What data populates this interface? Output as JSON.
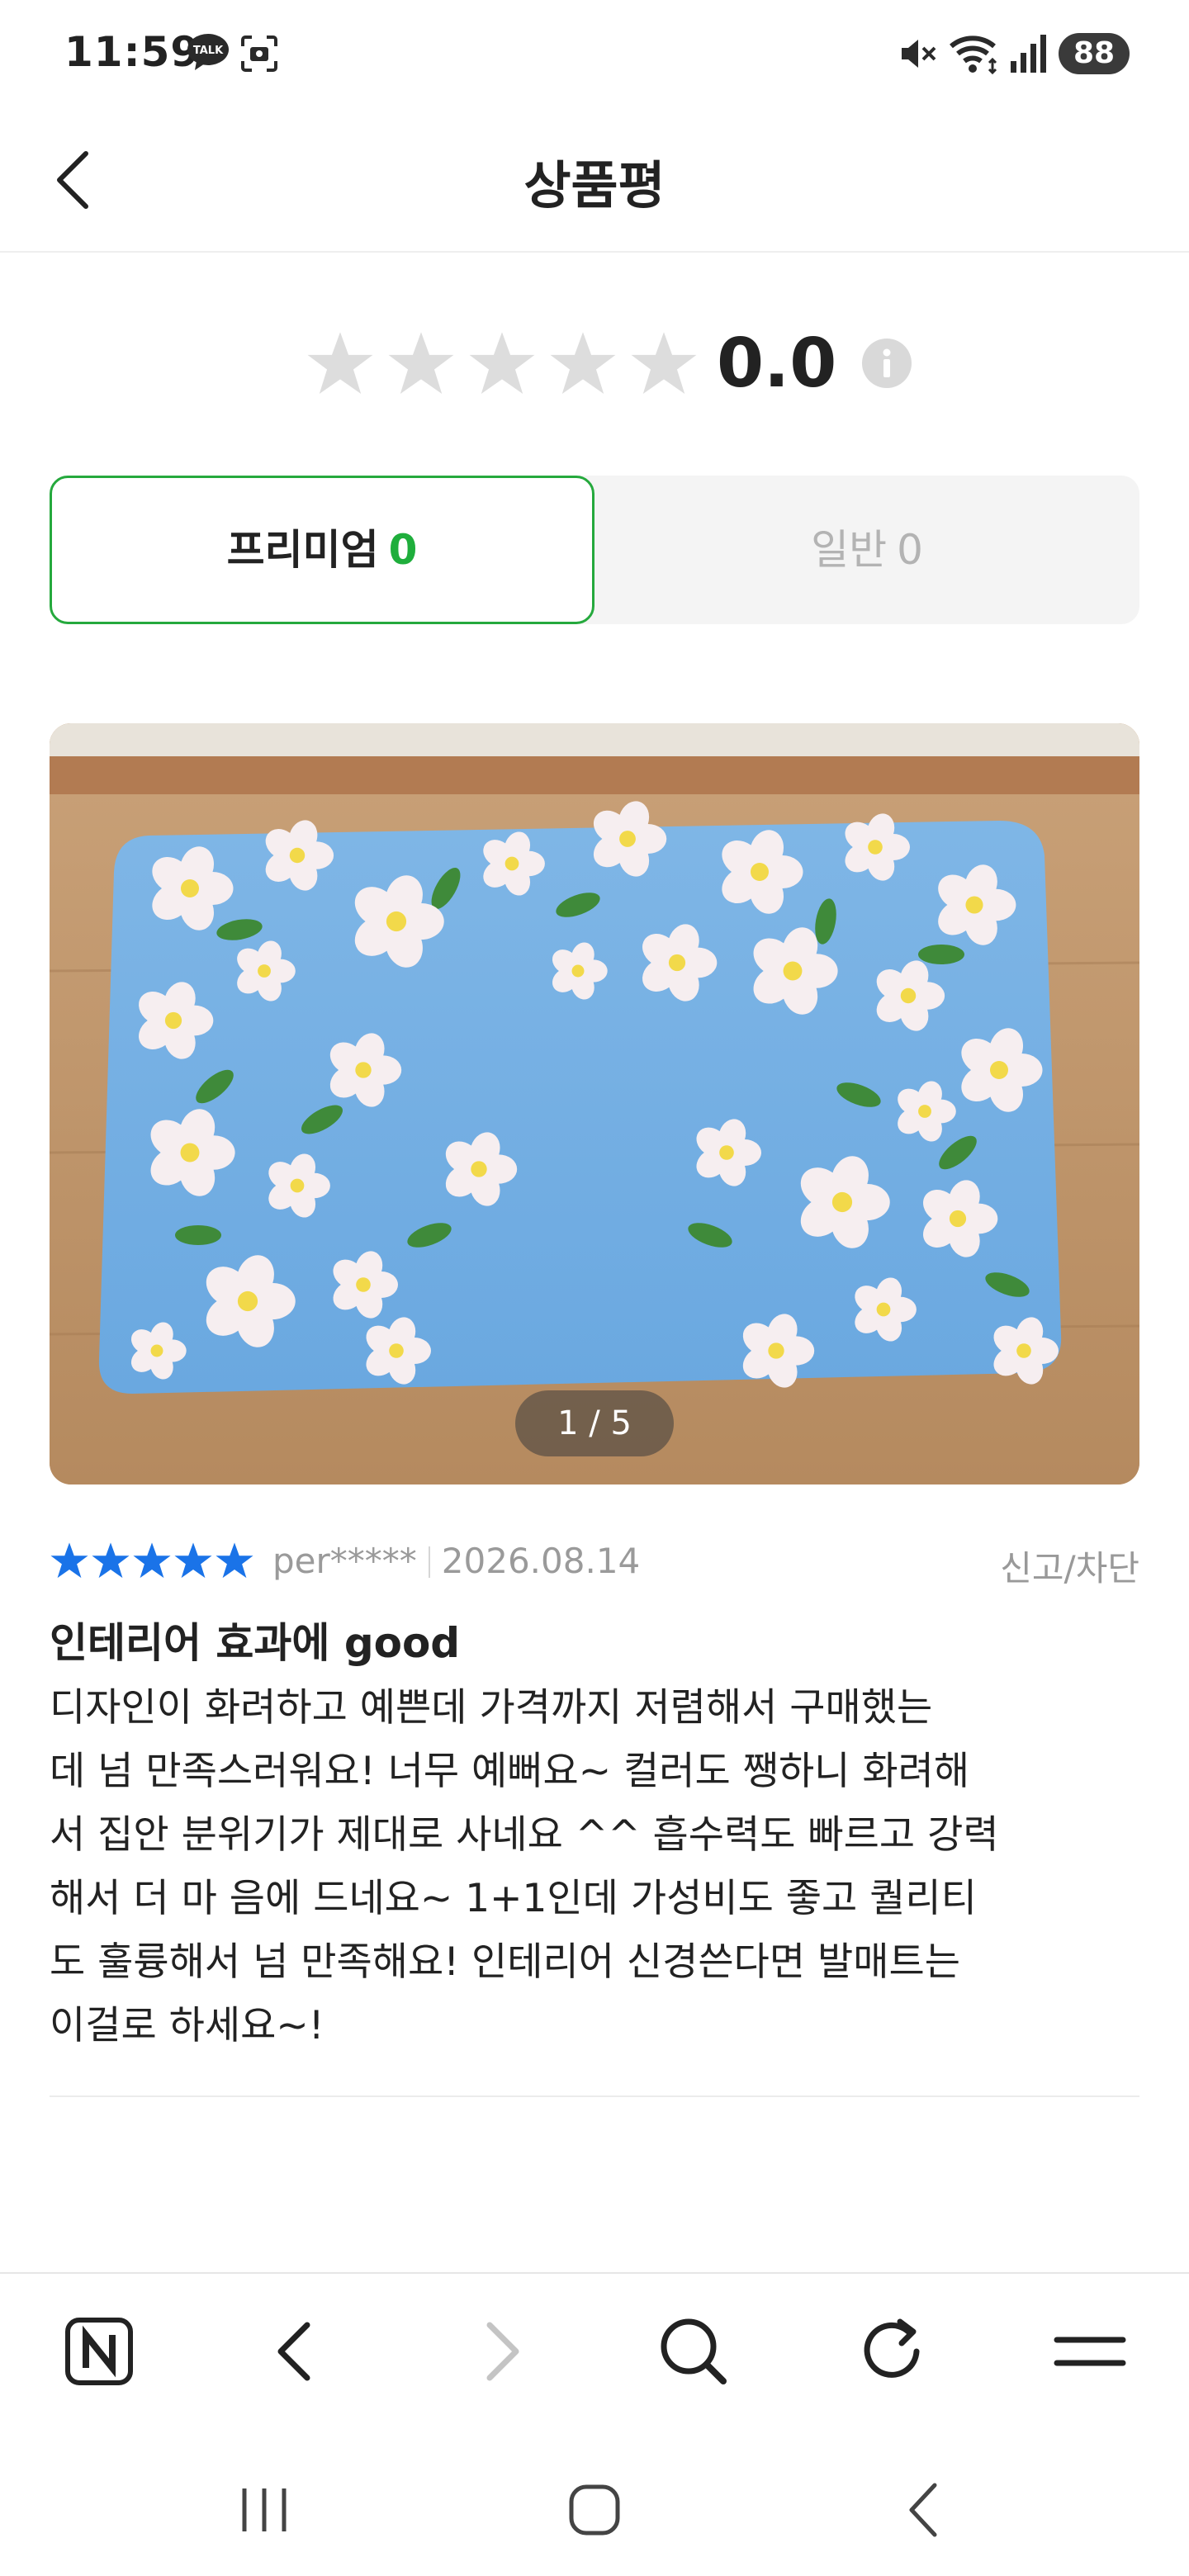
{
  "status_bar": {
    "time": "11:59",
    "battery": "88",
    "icons": [
      "kakaotalk-icon",
      "screenshot-scan-icon",
      "mute-icon",
      "wifi-icon",
      "signal-icon"
    ]
  },
  "header": {
    "title": "상품평",
    "back_icon": "chevron-left-icon"
  },
  "rating_summary": {
    "score": "0.0",
    "stars_filled": 0,
    "stars_total": 5,
    "star_empty_color": "#dddddd",
    "info_icon": "info-icon"
  },
  "tabs": [
    {
      "label": "프리미엄",
      "count": "0",
      "active": true
    },
    {
      "label": "일반",
      "count": "0",
      "active": false
    }
  ],
  "colors": {
    "accent_green": "#1fae3c",
    "star_blue": "#1a73e8"
  },
  "review": {
    "photo_counter": "1 / 5",
    "stars": 5,
    "reviewer": "per*****",
    "date": "2026.08.14",
    "report_label": "신고/차단",
    "title": "인테리어 효과에 good",
    "body_lines": [
      "디자인이 화려하고 예쁜데 가격까지 저렴해서 구매했는",
      "데 넘 만족스러워요! 너무 예뻐요~ 컬러도 쨍하니 화려해",
      "서 집안 분위기가 제대로 사네요 ^^ 흡수력도 빠르고 강력",
      "해서 더 마 음에 드네요~ 1+1인데 가성비도 좋고 퀄리티",
      "도 훌륭해서 넘 만족해요! 인테리어 신경쓴다면 발매트는",
      "이걸로 하세요~!"
    ]
  },
  "browser_toolbar": {
    "items": [
      "naver-n-icon",
      "back-arrow-icon",
      "forward-arrow-icon",
      "search-icon",
      "refresh-icon",
      "menu-icon"
    ]
  },
  "nav_bar": {
    "items": [
      "recent-apps-icon",
      "home-icon",
      "back-icon"
    ]
  }
}
